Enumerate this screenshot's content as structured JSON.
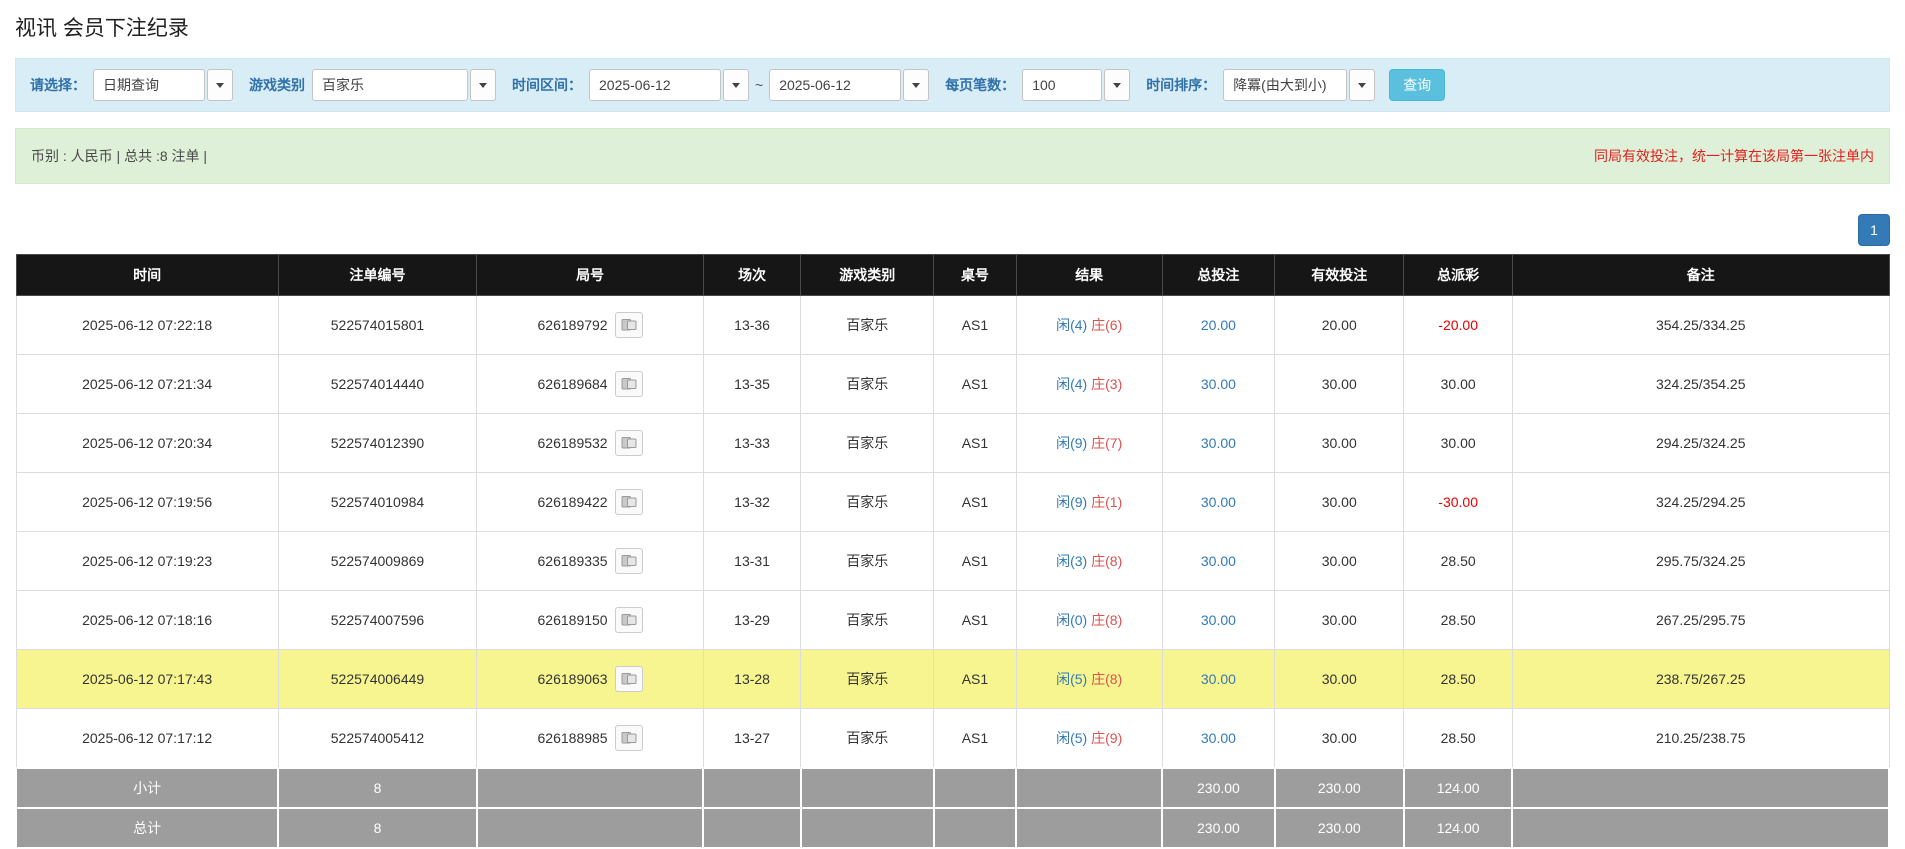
{
  "page": {
    "title": "视讯 会员下注纪录"
  },
  "filter": {
    "select_label": "请选择：",
    "select_value": "日期查询",
    "game_type_label": "游戏类别",
    "game_type_value": "百家乐",
    "time_range_label": "时间区间：",
    "date_from": "2025-06-12",
    "tilde": "~",
    "date_to": "2025-06-12",
    "page_size_label": "每页笔数：",
    "page_size_value": "100",
    "sort_label": "时间排序：",
    "sort_value": "降冪(由大到小)",
    "query_button": "查询"
  },
  "info_bar": {
    "left": "币别 : 人民币 | 总共 :8 注单 |",
    "right": "同局有效投注，统一计算在该局第一张注单内"
  },
  "pagination": {
    "current": "1"
  },
  "table": {
    "headers": [
      "时间",
      "注单编号",
      "局号",
      "场次",
      "游戏类别",
      "桌号",
      "结果",
      "总投注",
      "有效投注",
      "总派彩",
      "备注"
    ],
    "rows": [
      {
        "time": "2025-06-12 07:22:18",
        "bet_id": "522574015801",
        "round_id": "626189792",
        "session": "13-36",
        "game_type": "百家乐",
        "table_id": "AS1",
        "result_player": "闲(4)",
        "result_banker": "庄(6)",
        "total_bet": "20.00",
        "valid_bet": "20.00",
        "payout": "-20.00",
        "remark": "354.25/334.25",
        "highlighted": false
      },
      {
        "time": "2025-06-12 07:21:34",
        "bet_id": "522574014440",
        "round_id": "626189684",
        "session": "13-35",
        "game_type": "百家乐",
        "table_id": "AS1",
        "result_player": "闲(4)",
        "result_banker": "庄(3)",
        "total_bet": "30.00",
        "valid_bet": "30.00",
        "payout": "30.00",
        "remark": "324.25/354.25",
        "highlighted": false
      },
      {
        "time": "2025-06-12 07:20:34",
        "bet_id": "522574012390",
        "round_id": "626189532",
        "session": "13-33",
        "game_type": "百家乐",
        "table_id": "AS1",
        "result_player": "闲(9)",
        "result_banker": "庄(7)",
        "total_bet": "30.00",
        "valid_bet": "30.00",
        "payout": "30.00",
        "remark": "294.25/324.25",
        "highlighted": false
      },
      {
        "time": "2025-06-12 07:19:56",
        "bet_id": "522574010984",
        "round_id": "626189422",
        "session": "13-32",
        "game_type": "百家乐",
        "table_id": "AS1",
        "result_player": "闲(9)",
        "result_banker": "庄(1)",
        "total_bet": "30.00",
        "valid_bet": "30.00",
        "payout": "-30.00",
        "remark": "324.25/294.25",
        "highlighted": false
      },
      {
        "time": "2025-06-12 07:19:23",
        "bet_id": "522574009869",
        "round_id": "626189335",
        "session": "13-31",
        "game_type": "百家乐",
        "table_id": "AS1",
        "result_player": "闲(3)",
        "result_banker": "庄(8)",
        "total_bet": "30.00",
        "valid_bet": "30.00",
        "payout": "28.50",
        "remark": "295.75/324.25",
        "highlighted": false
      },
      {
        "time": "2025-06-12 07:18:16",
        "bet_id": "522574007596",
        "round_id": "626189150",
        "session": "13-29",
        "game_type": "百家乐",
        "table_id": "AS1",
        "result_player": "闲(0)",
        "result_banker": "庄(8)",
        "total_bet": "30.00",
        "valid_bet": "30.00",
        "payout": "28.50",
        "remark": "267.25/295.75",
        "highlighted": false
      },
      {
        "time": "2025-06-12 07:17:43",
        "bet_id": "522574006449",
        "round_id": "626189063",
        "session": "13-28",
        "game_type": "百家乐",
        "table_id": "AS1",
        "result_player": "闲(5)",
        "result_banker": "庄(8)",
        "total_bet": "30.00",
        "valid_bet": "30.00",
        "payout": "28.50",
        "remark": "238.75/267.25",
        "highlighted": true
      },
      {
        "time": "2025-06-12 07:17:12",
        "bet_id": "522574005412",
        "round_id": "626188985",
        "session": "13-27",
        "game_type": "百家乐",
        "table_id": "AS1",
        "result_player": "闲(5)",
        "result_banker": "庄(9)",
        "total_bet": "30.00",
        "valid_bet": "30.00",
        "payout": "28.50",
        "remark": "210.25/238.75",
        "highlighted": false
      }
    ],
    "subtotal": {
      "label": "小计",
      "count": "8",
      "total_bet": "230.00",
      "valid_bet": "230.00",
      "payout": "124.00"
    },
    "total": {
      "label": "总计",
      "count": "8",
      "total_bet": "230.00",
      "valid_bet": "230.00",
      "payout": "124.00"
    }
  },
  "icons": {
    "dropdown_caret": "caret-down-icon ▼",
    "round_replay": "cards-icon"
  },
  "colors": {
    "filter_bar_bg": "#d9edf7",
    "label_blue": "#3071a9",
    "query_button_bg": "#5bc0de",
    "info_bar_bg": "#dff0d8",
    "notice_red": "#e02020",
    "pagination_blue": "#337ab7",
    "table_header_bg": "#161616",
    "highlight_row_bg": "#f7f590",
    "player_blue": "#337ab7",
    "banker_red": "#d9534f",
    "negative_red": "#e60000",
    "footer_row_bg": "#9d9d9d"
  }
}
